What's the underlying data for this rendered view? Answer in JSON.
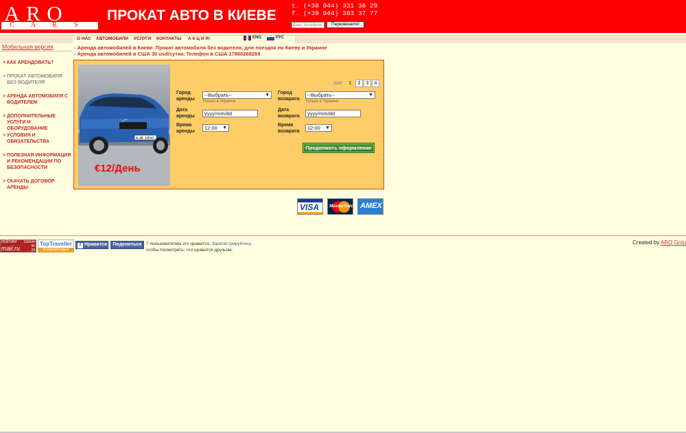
{
  "header": {
    "logo_big": [
      "A",
      "R",
      "O"
    ],
    "logo_small": [
      "C",
      "A",
      "R",
      "S"
    ],
    "title": "ПРОКАТ АВТО В КИЕВЕ",
    "phone1": "t. (+38 044) 331 36 29",
    "phone2": "f. (+38 044) 383 37 77",
    "callback_placeholder": "Ваш телефон",
    "callback_button": "Перезвоните!"
  },
  "nav": {
    "items": [
      "О НАС",
      "АВТОМОБИЛИ",
      "УСЛУГИ",
      "КОНТАКТЫ",
      "А К Ц И Я!"
    ],
    "lang_en": "ENG",
    "lang_ru": "РУС"
  },
  "sidebar": {
    "mobile_link": "Мобильная версия",
    "marker": ">",
    "items": [
      {
        "label": "КАК АРЕНДОВАТЬ?"
      },
      {
        "label": "ПРОКАТ АВТОМОБИЛЯ БЕЗ ВОДИТЕЛЯ"
      },
      {
        "label": "АРЕНДА АВТОМОБИЛЯ С ВОДИТЕЛЕМ"
      },
      {
        "label": "ДОПОЛНИТЕЛЬНЫЕ УСЛУГИ И ОБОРУДОВАНИЕ"
      },
      {
        "label": "УСЛОВИЯ И ОБЯЗАТЕЛЬСТВА"
      },
      {
        "label": "ПОЛЕЗНАЯ ИНФОРМАЦИЯ И РЕКОМЕНДАЦИИ ПО БЕЗОПАСНОСТИ"
      },
      {
        "label": "СКАЧАТЬ ДОГОВОР АРЕНДЫ"
      }
    ]
  },
  "info": {
    "line1": "- Аренда автомобилей в Киеве. Прокат автомобиля без водителя, для поездок по Киеву и Украине",
    "line2": "- Аренда автомобилей в США 30 usd/сутки. Телефон в США 17866268268"
  },
  "booking": {
    "price": "€12/День",
    "car_plate": "K-JB 2800",
    "step_label": "Шаг",
    "steps": [
      "1",
      "2",
      "3",
      "4"
    ],
    "pickup_city_label": "Город аренды",
    "return_city_label": "Город возврата",
    "select_placeholder": "--Выбрать--",
    "hint_ukraine": "Только в Украине",
    "pickup_date_label": "Дата аренды",
    "return_date_label": "Дата возврата",
    "date_placeholder": "yyyy/mm/dd",
    "pickup_time_label": "Время аренды",
    "return_time_label": "Время возврата",
    "time_value": "12:00",
    "continue_button": "Продолжить оформление"
  },
  "payments": {
    "visa": "VISA",
    "mastercard": "MasterCard",
    "amex": "AMEX"
  },
  "footer": {
    "mail_label": "РЕЙТИНГ",
    "mail_count": "192644",
    "mail_brand": "mail.ru",
    "mail_sub1": "96",
    "mail_sub2": "29",
    "top_traveller": "TopTraveller",
    "top_traveller_sub": "Активный отдых",
    "fb_like": "Нравится",
    "fb_share": "Поделиться",
    "fb_count_text": "7 пользователям это нравится.",
    "fb_register": "Зарегистрируйтесь,",
    "fb_text2": "чтобы посмотреть, что нравится друзьям.",
    "credit_prefix": "Created by",
    "credit_link": "ARO Group"
  }
}
